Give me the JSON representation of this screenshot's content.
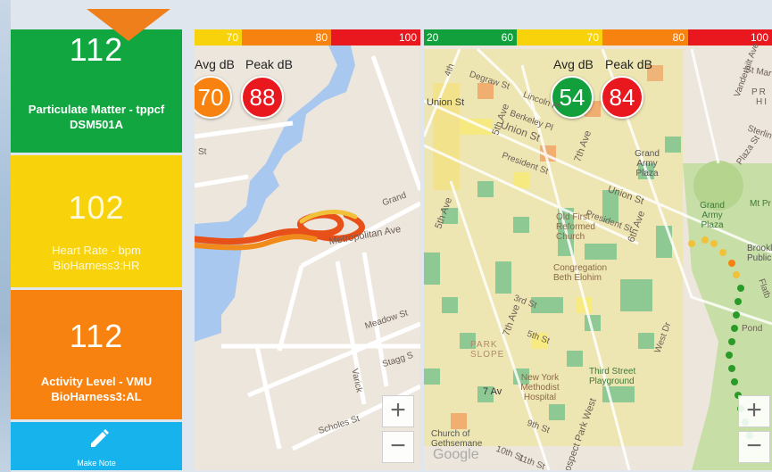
{
  "sensors": [
    {
      "value": "112",
      "label_line1": "Particulate Matter - tppcf",
      "label_line2": "DSM501A",
      "color": "#11a640"
    },
    {
      "value": "102",
      "label_line1": "Heart Rate - bpm",
      "label_line2": "BioHarness3:HR",
      "color": "#f8d20b"
    },
    {
      "value": "112",
      "label_line1": "Activity Level - VMU",
      "label_line2": "BioHarness3:AL",
      "color": "#f7820f"
    }
  ],
  "note_button": {
    "label": "Make Note",
    "icon": "pencil-icon",
    "color": "#16b3ec"
  },
  "map_left": {
    "scale": [
      "70",
      "80",
      "100"
    ],
    "avg_label": "Avg dB",
    "peak_label": "Peak dB",
    "avg_value": "70",
    "peak_value": "88",
    "avg_color": "#f7820f",
    "peak_color": "#e8181e",
    "streets": {
      "st": "St",
      "grand": "Grand",
      "metropolitan": "Metropolitan Ave",
      "meadow": "Meadow St",
      "stagg": "Stagg S",
      "varick": "Varick",
      "scholes": "Scholes St"
    },
    "zoom_in": "+",
    "zoom_out": "−"
  },
  "map_right": {
    "scale": [
      "20",
      "60",
      "70",
      "80",
      "100"
    ],
    "avg_label": "Avg dB",
    "peak_label": "Peak dB",
    "avg_value": "54",
    "peak_value": "84",
    "avg_color": "#12a03c",
    "peak_color": "#e8181e",
    "labels": {
      "union_st_station": "Union St",
      "degraw": "Degraw St",
      "union_st": "Union St",
      "berkeley": "Berkeley Pl",
      "lincoln": "Lincoln Pl",
      "president": "President St",
      "fifth_ave": "5th Ave",
      "fifth_ave_2": "5th Ave",
      "seventh_ave": "7th Ave",
      "seventh_ave_2": "7th Ave",
      "sixth_ave": "6th Ave",
      "union_st_2": "Union St",
      "president_2": "President St",
      "fourth": "4th",
      "third_st": "3rd St",
      "fifth_st": "5th St",
      "ninth_st": "9th St",
      "tenth_st": "10th St",
      "eleventh_st": "11th St",
      "seventh_ave_station": "7 Av",
      "prospect_park_west": "rospect Park West",
      "west_dr": "West Dr",
      "pond": "Pond",
      "vanderbilt": "Vanderbilt Ave",
      "plaza_st": "Plaza St",
      "st_mark": "St Mar",
      "sterling": "Sterlin",
      "pr": "PR",
      "hi": "HI",
      "flatbush": "Flatb",
      "grand_army_plaza": "Grand Army Plaza",
      "grand_army_plaza_2": "Grand Army Plaza",
      "mt_pr": "Mt Pr",
      "brooklyn_public": "Brookl Public",
      "old_first": "Old First Reformed Church",
      "congregation": "Congregation Beth Elohim",
      "park_slope": "PARK SLOPE",
      "ny_methodist": "New York Methodist Hospital",
      "third_street_playground": "Third Street Playground",
      "church_of_gethsemane": "Church of Gethsemane",
      "google": "Google"
    },
    "zoom_in": "+",
    "zoom_out": "−"
  }
}
